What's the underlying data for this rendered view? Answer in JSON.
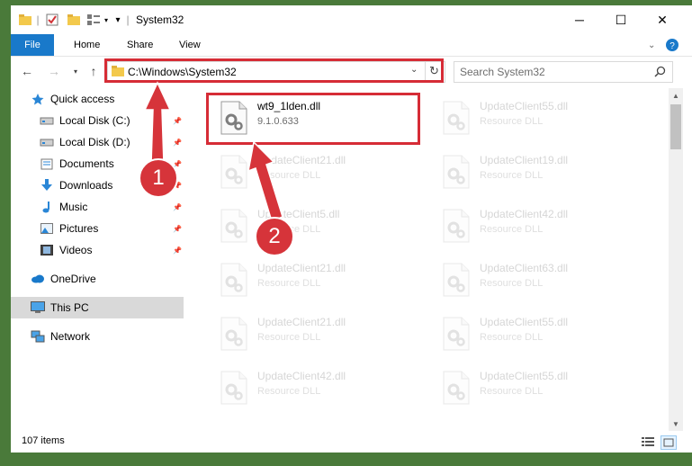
{
  "window": {
    "title": "System32",
    "controls": {
      "minimize": "─",
      "maximize": "☐",
      "close": "✕"
    }
  },
  "ribbon": {
    "tabs": [
      "File",
      "Home",
      "Share",
      "View"
    ]
  },
  "navbar": {
    "address": "C:\\Windows\\System32",
    "search_placeholder": "Search System32"
  },
  "sidebar": {
    "items": [
      {
        "label": "Quick access",
        "icon": "star-icon",
        "pinned": false
      },
      {
        "label": "Local Disk (C:)",
        "icon": "drive-icon",
        "pinned": true
      },
      {
        "label": "Local Disk (D:)",
        "icon": "drive-icon",
        "pinned": true
      },
      {
        "label": "Documents",
        "icon": "documents-icon",
        "pinned": true
      },
      {
        "label": "Downloads",
        "icon": "download-icon",
        "pinned": true
      },
      {
        "label": "Music",
        "icon": "music-icon",
        "pinned": true
      },
      {
        "label": "Pictures",
        "icon": "pictures-icon",
        "pinned": true
      },
      {
        "label": "Videos",
        "icon": "videos-icon",
        "pinned": true
      },
      {
        "label": "OneDrive",
        "icon": "cloud-icon",
        "pinned": false
      },
      {
        "label": "This PC",
        "icon": "computer-icon",
        "pinned": false,
        "selected": true
      },
      {
        "label": "Network",
        "icon": "network-icon",
        "pinned": false
      }
    ]
  },
  "files": [
    {
      "name": "wt9_1lden.dll",
      "sub": "9.1.0.633",
      "highlighted": true
    },
    {
      "name": "UpdateClient55.dll",
      "sub": "Resource DLL"
    },
    {
      "name": "UpdateClient21.dll",
      "sub": "Resource DLL"
    },
    {
      "name": "UpdateClient19.dll",
      "sub": "Resource DLL"
    },
    {
      "name": "UpdateClient5.dll",
      "sub": "Resource DLL"
    },
    {
      "name": "UpdateClient42.dll",
      "sub": "Resource DLL"
    },
    {
      "name": "UpdateClient21.dll",
      "sub": "Resource DLL"
    },
    {
      "name": "UpdateClient63.dll",
      "sub": "Resource DLL"
    },
    {
      "name": "UpdateClient21.dll",
      "sub": "Resource DLL"
    },
    {
      "name": "UpdateClient55.dll",
      "sub": "Resource DLL"
    },
    {
      "name": "UpdateClient42.dll",
      "sub": "Resource DLL"
    },
    {
      "name": "UpdateClient55.dll",
      "sub": "Resource DLL"
    }
  ],
  "status": {
    "count": "107 items"
  },
  "annotations": {
    "step1": "1",
    "step2": "2",
    "color": "#d62c36"
  },
  "colors": {
    "accent": "#1979ca",
    "selected_nav": "#d9d9d9"
  }
}
